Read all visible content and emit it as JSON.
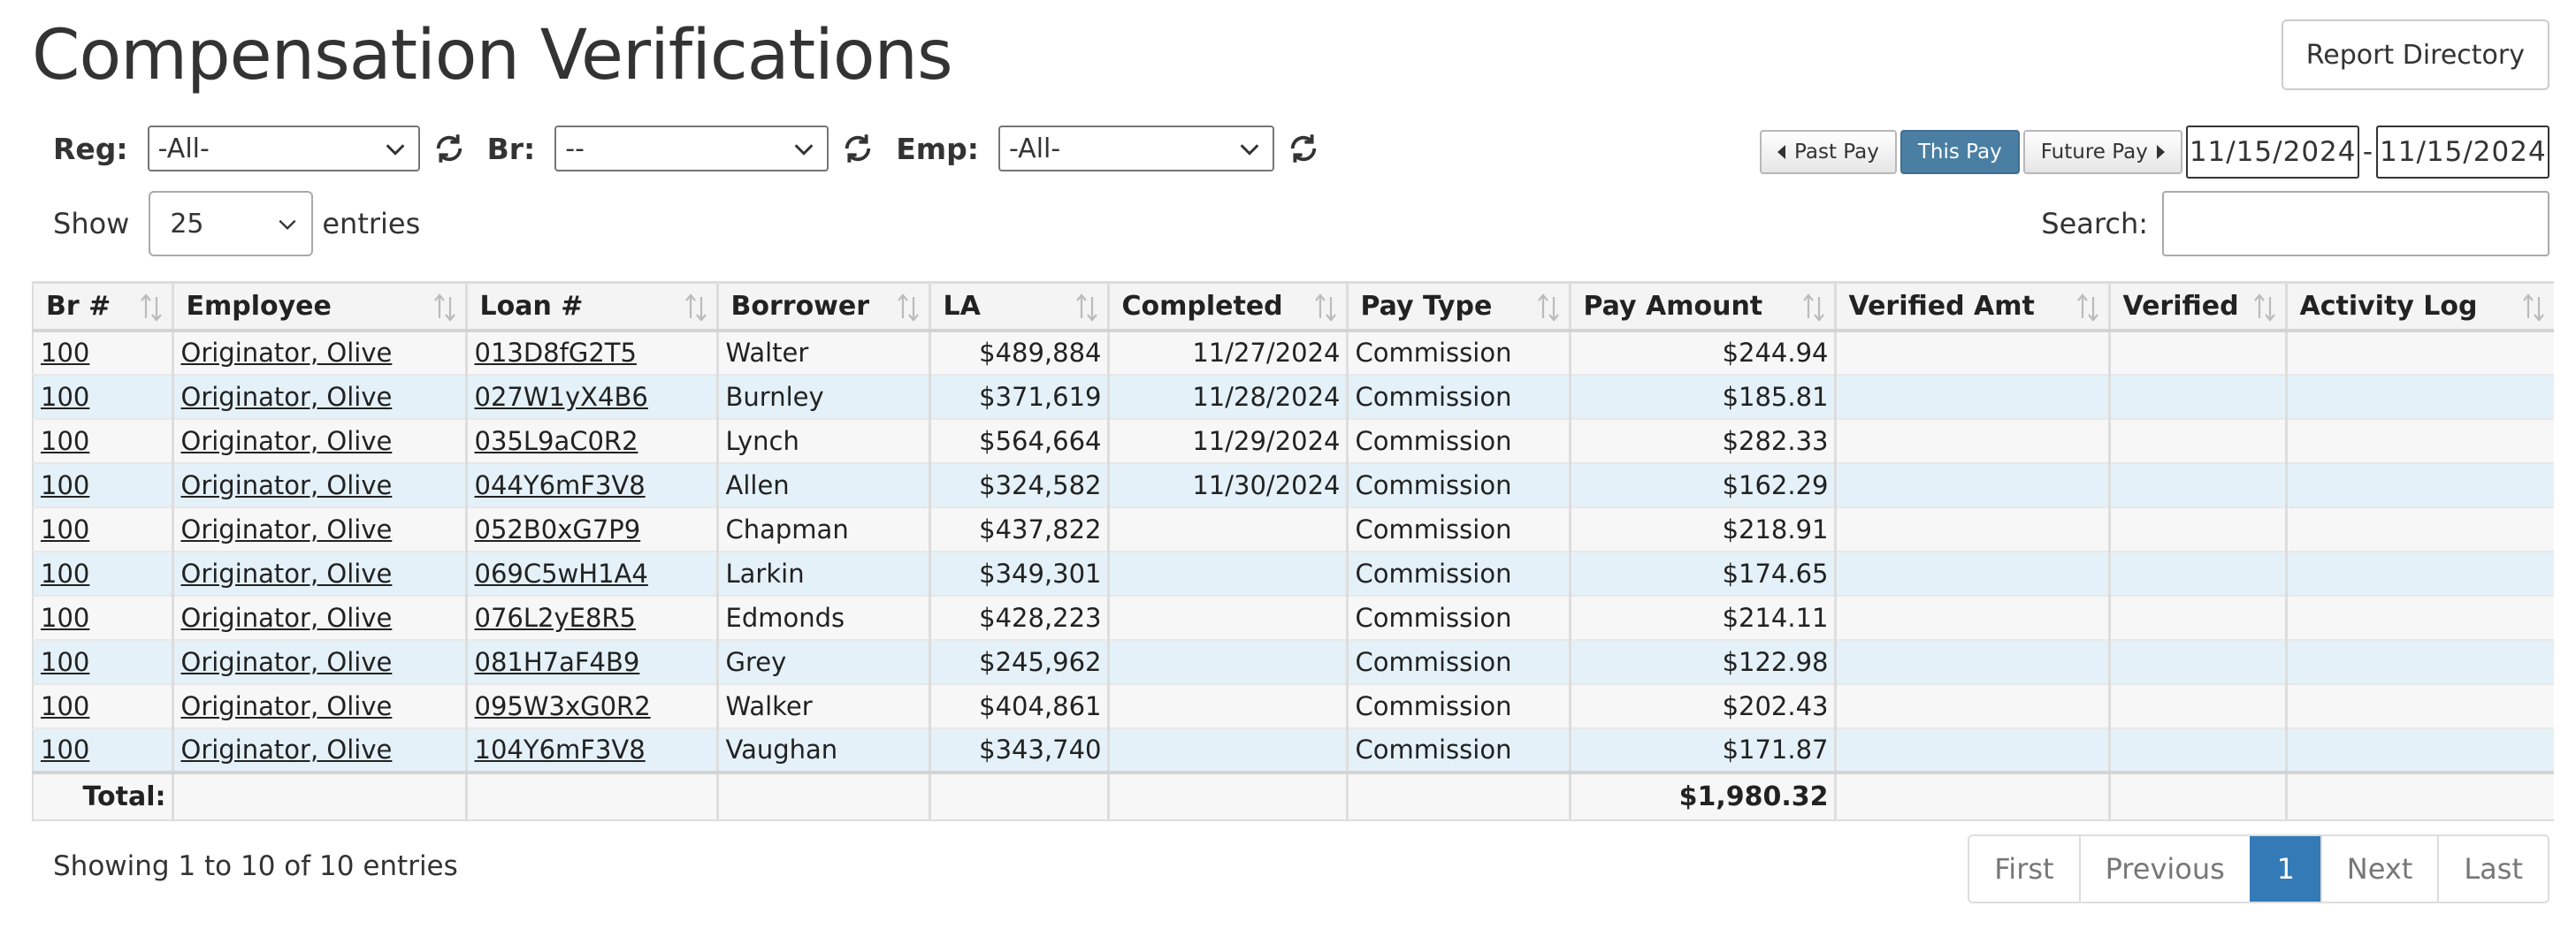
{
  "header": {
    "title": "Compensation Verifications",
    "report_directory_label": "Report Directory"
  },
  "filters": {
    "region": {
      "label": "Reg:",
      "value": "-All-"
    },
    "branch": {
      "label": "Br:",
      "value": "--"
    },
    "employee": {
      "label": "Emp:",
      "value": "-All-"
    }
  },
  "pay_period": {
    "past_label": "Past Pay",
    "this_label": "This Pay",
    "future_label": "Future Pay",
    "start_date": "11/15/2024",
    "separator": "-",
    "end_date": "11/15/2024"
  },
  "length": {
    "show_label": "Show",
    "value": "25",
    "entries_label": "entries"
  },
  "search": {
    "label": "Search:",
    "value": ""
  },
  "table": {
    "columns": [
      "Br #",
      "Employee",
      "Loan #",
      "Borrower",
      "LA",
      "Completed",
      "Pay Type",
      "Pay Amount",
      "Verified Amt",
      "Verified",
      "Activity Log"
    ],
    "rows": [
      {
        "br": "100",
        "employee": "Originator, Olive",
        "loan": "013D8fG2T5",
        "borrower": "Walter",
        "la": "$489,884",
        "completed": "11/27/2024",
        "pay_type": "Commission",
        "pay_amount": "$244.94",
        "verified_amt": "",
        "verified": "",
        "activity_log": ""
      },
      {
        "br": "100",
        "employee": "Originator, Olive",
        "loan": "027W1yX4B6",
        "borrower": "Burnley",
        "la": "$371,619",
        "completed": "11/28/2024",
        "pay_type": "Commission",
        "pay_amount": "$185.81",
        "verified_amt": "",
        "verified": "",
        "activity_log": ""
      },
      {
        "br": "100",
        "employee": "Originator, Olive",
        "loan": "035L9aC0R2",
        "borrower": "Lynch",
        "la": "$564,664",
        "completed": "11/29/2024",
        "pay_type": "Commission",
        "pay_amount": "$282.33",
        "verified_amt": "",
        "verified": "",
        "activity_log": ""
      },
      {
        "br": "100",
        "employee": "Originator, Olive",
        "loan": "044Y6mF3V8",
        "borrower": "Allen",
        "la": "$324,582",
        "completed": "11/30/2024",
        "pay_type": "Commission",
        "pay_amount": "$162.29",
        "verified_amt": "",
        "verified": "",
        "activity_log": ""
      },
      {
        "br": "100",
        "employee": "Originator, Olive",
        "loan": "052B0xG7P9",
        "borrower": "Chapman",
        "la": "$437,822",
        "completed": "",
        "pay_type": "Commission",
        "pay_amount": "$218.91",
        "verified_amt": "",
        "verified": "",
        "activity_log": ""
      },
      {
        "br": "100",
        "employee": "Originator, Olive",
        "loan": "069C5wH1A4",
        "borrower": "Larkin",
        "la": "$349,301",
        "completed": "",
        "pay_type": "Commission",
        "pay_amount": "$174.65",
        "verified_amt": "",
        "verified": "",
        "activity_log": ""
      },
      {
        "br": "100",
        "employee": "Originator, Olive",
        "loan": "076L2yE8R5",
        "borrower": "Edmonds",
        "la": "$428,223",
        "completed": "",
        "pay_type": "Commission",
        "pay_amount": "$214.11",
        "verified_amt": "",
        "verified": "",
        "activity_log": ""
      },
      {
        "br": "100",
        "employee": "Originator, Olive",
        "loan": "081H7aF4B9",
        "borrower": "Grey",
        "la": "$245,962",
        "completed": "",
        "pay_type": "Commission",
        "pay_amount": "$122.98",
        "verified_amt": "",
        "verified": "",
        "activity_log": ""
      },
      {
        "br": "100",
        "employee": "Originator, Olive",
        "loan": "095W3xG0R2",
        "borrower": "Walker",
        "la": "$404,861",
        "completed": "",
        "pay_type": "Commission",
        "pay_amount": "$202.43",
        "verified_amt": "",
        "verified": "",
        "activity_log": ""
      },
      {
        "br": "100",
        "employee": "Originator, Olive",
        "loan": "104Y6mF3V8",
        "borrower": "Vaughan",
        "la": "$343,740",
        "completed": "",
        "pay_type": "Commission",
        "pay_amount": "$171.87",
        "verified_amt": "",
        "verified": "",
        "activity_log": ""
      }
    ],
    "footer": {
      "total_label": "Total:",
      "pay_amount_total": "$1,980.32"
    }
  },
  "info": {
    "text": "Showing 1 to 10 of 10 entries"
  },
  "pagination": {
    "first": "First",
    "previous": "Previous",
    "current": "1",
    "next": "Next",
    "last": "Last"
  },
  "icons": {
    "refresh": "refresh-icon",
    "chevron": "chevron-down-icon",
    "sort": "sort-icon",
    "prev": "caret-left-icon",
    "next": "caret-right-icon"
  },
  "colors": {
    "active_pay": "#4a7fa3",
    "active_page": "#337ab7",
    "row_odd": "#f7f7f7",
    "row_even": "#e4f1f8"
  }
}
